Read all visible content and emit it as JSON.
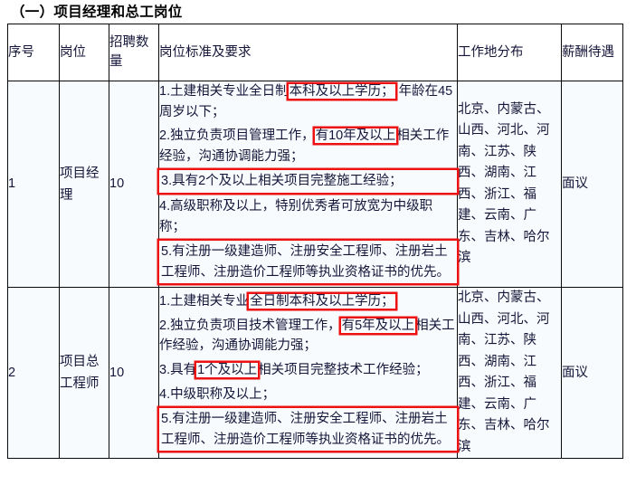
{
  "title": "（一）项目经理和总工岗位",
  "table": {
    "headers": [
      "序号",
      "岗位",
      "招聘数量",
      "岗位标准及要求",
      "工作地分布",
      "薪酬待遇"
    ],
    "rows": [
      {
        "no": "1",
        "post": "项目经理",
        "count": "10",
        "requirements": [
          {
            "pre": "1.土建相关专业全日制",
            "highlight": "本科及以上学历；",
            "post": " 年龄在45周岁以下；",
            "style": "inline"
          },
          {
            "pre": "2.独立负责项目管理工作，",
            "highlight": "有10年及以上",
            "post": "相关工作经验，沟通协调能力强；",
            "style": "inline"
          },
          {
            "pre": "",
            "highlight": "3.具有2个及以上相关项目完整施工经验；",
            "post": "",
            "style": "block"
          },
          {
            "pre": "4.高级职称及以上，特别优秀者可放宽为中级职称；",
            "highlight": "",
            "post": "",
            "style": "plain"
          },
          {
            "pre": "",
            "highlight": "5.有注册一级建造师、注册安全工程师、注册岩土工程师、注册造价工程师等执业资格证书的优先。",
            "post": "",
            "style": "block"
          }
        ],
        "location": "北京、内蒙古、山西、河北、河南、江苏、陕西、湖南、江西、浙江、福建、云南、广东、吉林、哈尔滨",
        "pay": "面议"
      },
      {
        "no": "2",
        "post": "项目总工程师",
        "count": "10",
        "requirements": [
          {
            "pre": "1.土建相关专业",
            "highlight": "全日制本科及以上学历；",
            "post": "",
            "style": "inline"
          },
          {
            "pre": "2.独立负责项目技术管理工作，",
            "highlight": "有5年及以上",
            "post": "相关工作经验，沟通协调能力强；",
            "style": "inline"
          },
          {
            "pre": "3.具有",
            "highlight": "1个及以上",
            "post": "相关项目完整技术工作经验；",
            "style": "inline"
          },
          {
            "pre": "4.中级职称及以上；",
            "highlight": "",
            "post": "",
            "style": "plain"
          },
          {
            "pre": "",
            "highlight": "5.有注册一级建造师、注册安全工程师、注册岩土工程师、注册造价工程师等执业资格证书的优先。",
            "post": "",
            "style": "block"
          }
        ],
        "location": "北京、内蒙古、山西、河北、河南、江苏、陕西、湖南、江西、浙江、福建、云南、广东、吉林、哈尔滨",
        "pay": "面议"
      }
    ]
  },
  "colors": {
    "annotation": "#ee1111",
    "text": "#16163a",
    "cell_background": "#f8fbfd",
    "border": "#0a0a0a"
  }
}
